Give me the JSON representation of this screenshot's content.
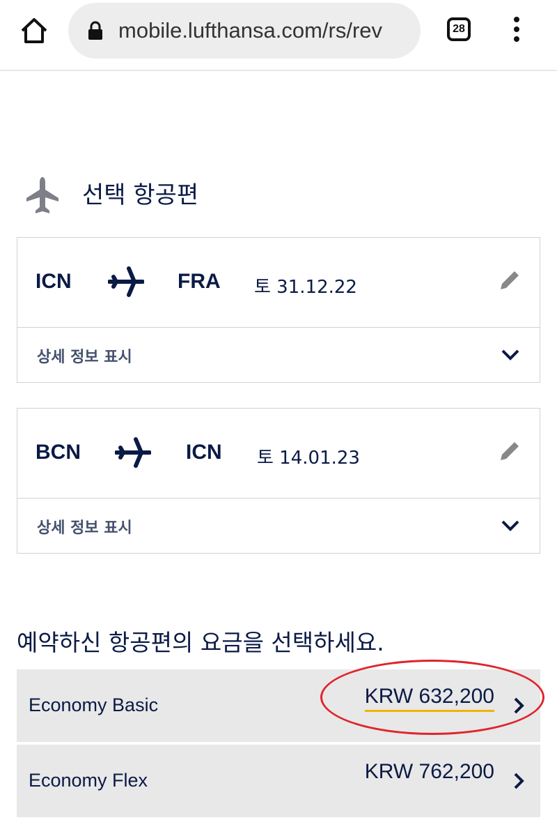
{
  "browser": {
    "url": "mobile.lufthansa.com/rs/rev",
    "tab_count": "28"
  },
  "section_title": "선택 항공편",
  "flights": [
    {
      "origin": "ICN",
      "destination": "FRA",
      "date": "토 31.12.22",
      "details_label": "상세 정보 표시"
    },
    {
      "origin": "BCN",
      "destination": "ICN",
      "date": "토 14.01.23",
      "details_label": "상세 정보 표시"
    }
  ],
  "fare_prompt": "예약하신 항공편의 요금을 선택하세요.",
  "fares": [
    {
      "name": "Economy Basic",
      "price": "KRW 632,200"
    },
    {
      "name": "Economy Flex",
      "price": "KRW 762,200"
    }
  ],
  "colors": {
    "navy": "#0b1a45",
    "accent_underline": "#f2b200",
    "annotation_circle": "#e0242b"
  }
}
